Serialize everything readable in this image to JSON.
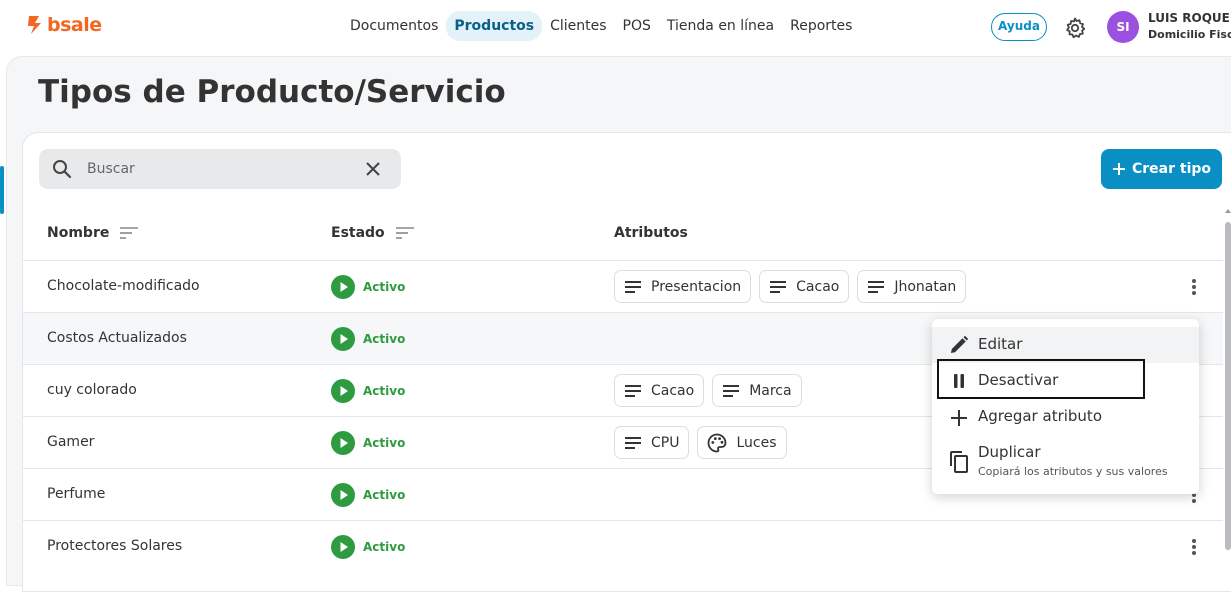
{
  "brand": {
    "name": "bsale",
    "logo_color": "#f26722"
  },
  "nav": {
    "items": [
      {
        "label": "Documentos",
        "active": false
      },
      {
        "label": "Productos",
        "active": true
      },
      {
        "label": "Clientes",
        "active": false
      },
      {
        "label": "POS",
        "active": false
      },
      {
        "label": "Tienda en línea",
        "active": false
      },
      {
        "label": "Reportes",
        "active": false
      }
    ]
  },
  "header": {
    "help_label": "Ayuda",
    "settings_icon": "gear-icon",
    "avatar_initials": "SI",
    "user_name": "LUIS ROQUE",
    "user_subtitle": "Domicilio Fisca"
  },
  "page": {
    "title": "Tipos de Producto/Servicio"
  },
  "search": {
    "placeholder": "Buscar",
    "value": ""
  },
  "toolbar": {
    "create_label": "Crear tipo",
    "create_icon": "plus-icon"
  },
  "table": {
    "columns": [
      {
        "label": "Nombre",
        "sortable": true
      },
      {
        "label": "Estado",
        "sortable": true
      },
      {
        "label": "Atributos",
        "sortable": false
      }
    ],
    "rows": [
      {
        "name": "Chocolate-modificado",
        "status": "Activo",
        "attributes": [
          {
            "label": "Presentacion",
            "icon": "lines-icon"
          },
          {
            "label": "Cacao",
            "icon": "lines-icon"
          },
          {
            "label": "Jhonatan",
            "icon": "lines-icon"
          }
        ]
      },
      {
        "name": "Costos Actualizados",
        "status": "Activo",
        "attributes": []
      },
      {
        "name": "cuy colorado",
        "status": "Activo",
        "attributes": [
          {
            "label": "Cacao",
            "icon": "lines-icon"
          },
          {
            "label": "Marca",
            "icon": "lines-icon"
          }
        ]
      },
      {
        "name": "Gamer",
        "status": "Activo",
        "attributes": [
          {
            "label": "CPU",
            "icon": "lines-icon"
          },
          {
            "label": "Luces",
            "icon": "palette-icon"
          }
        ]
      },
      {
        "name": "Perfume",
        "status": "Activo",
        "attributes": []
      },
      {
        "name": "Protectores Solares",
        "status": "Activo",
        "attributes": []
      }
    ]
  },
  "context_menu": {
    "items": [
      {
        "label": "Editar",
        "icon": "pencil-icon"
      },
      {
        "label": "Desactivar",
        "icon": "pause-icon"
      },
      {
        "label": "Agregar atributo",
        "icon": "plus-icon"
      },
      {
        "label": "Duplicar",
        "sublabel": "Copiará los atributos y sus valores",
        "icon": "copy-icon"
      }
    ]
  },
  "colors": {
    "accent": "#0a8fc4",
    "active_green": "#2e9b41",
    "avatar": "#9b51e0"
  }
}
